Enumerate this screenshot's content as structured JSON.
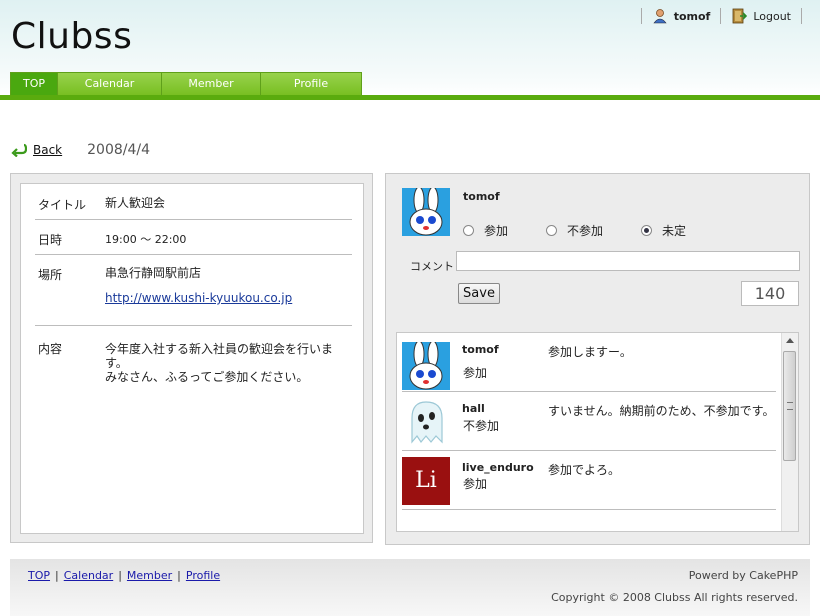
{
  "app": {
    "logo": "Clubss"
  },
  "userbar": {
    "username": "tomof",
    "logout_label": "Logout"
  },
  "nav": {
    "tabs": [
      {
        "label": "TOP",
        "active": true
      },
      {
        "label": "Calendar",
        "active": false
      },
      {
        "label": "Member",
        "active": false
      },
      {
        "label": "Profile",
        "active": false
      }
    ]
  },
  "page": {
    "back_label": "Back",
    "date": "2008/4/4"
  },
  "event": {
    "title_label": "タイトル",
    "title": "新人歓迎会",
    "time_label": "日時",
    "time": "19:00 〜 22:00",
    "place_label": "場所",
    "place": "串急行静岡駅前店",
    "place_url": "http://www.kushi-kyuukou.co.jp",
    "content_label": "内容",
    "content_line1": "今年度入社する新入社員の歓迎会を行います。",
    "content_line2": "みなさん、ふるってご参加ください。"
  },
  "rsvp": {
    "username": "tomof",
    "options": [
      "参加",
      "不参加",
      "未定"
    ],
    "selected": "未定",
    "comment_label": "コメント",
    "comment_value": "",
    "save_label": "Save",
    "counter": "140"
  },
  "comments": [
    {
      "name": "tomof",
      "status": "参加",
      "text": "参加しますー。",
      "avatar": "rabbit-avatar"
    },
    {
      "name": "hall",
      "status": "不参加",
      "text": "すいません。納期前のため、不参加です。",
      "avatar": "ghost-avatar"
    },
    {
      "name": "live_enduro",
      "status": "参加",
      "text": "参加でよろ。",
      "avatar": "li-avatar",
      "avatar_text": "Li"
    }
  ],
  "footer": {
    "links": [
      "TOP",
      "Calendar",
      "Member",
      "Profile"
    ],
    "powered": "Powerd by CakePHP",
    "copyright": "Copyright © 2008 Clubss All rights reserved."
  },
  "colors": {
    "nav_green": "#78bf22",
    "bar_green": "#5aab0e",
    "li_red": "#9a1010"
  }
}
